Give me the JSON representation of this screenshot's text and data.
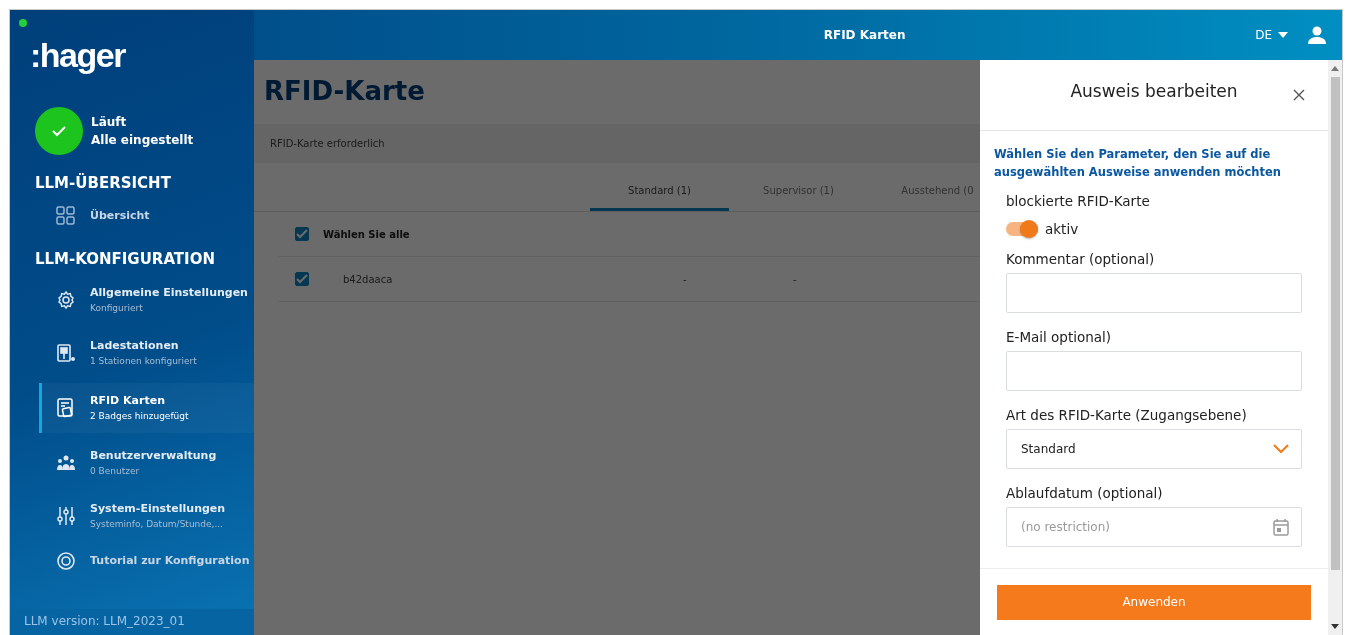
{
  "sidebar": {
    "logo": ":hager",
    "status": {
      "title": "Läuft",
      "subtitle": "Alle eingestellt"
    },
    "sections": [
      {
        "heading": "LLM-ÜBERSICHT",
        "items": [
          {
            "kind": "grid",
            "label": "Übersicht",
            "selected": false
          }
        ]
      },
      {
        "heading": "LLM-KONFIGURATION",
        "items": [
          {
            "kind": "gear",
            "label": "Allgemeine Einstellungen",
            "subtitle": "Konfiguriert",
            "selected": false
          },
          {
            "kind": "charger",
            "label": "Ladestationen",
            "subtitle": "1 Stationen konfiguriert",
            "selected": false
          },
          {
            "kind": "card",
            "label": "RFID Karten",
            "subtitle": "2 Badges hinzugefügt",
            "selected": true
          },
          {
            "kind": "users",
            "label": "Benutzerverwaltung",
            "subtitle": "0 Benutzer",
            "selected": false
          },
          {
            "kind": "sliders",
            "label": "System-Einstellungen",
            "subtitle": "Systeminfo, Datum/Stunde,...",
            "selected": false
          },
          {
            "kind": "help",
            "label": "Tutorial zur Konfiguration",
            "selected": false
          }
        ]
      }
    ],
    "version": "LLM version: LLM_2023_01"
  },
  "top_bar": {
    "title": "RFID Karten",
    "language": "DE"
  },
  "page": {
    "title": "RFID-Karte",
    "subheader": "RFID-Karte erforderlich",
    "tabs": [
      {
        "label": "Standard (1)",
        "selected": true
      },
      {
        "label": "Supervisor (1)",
        "selected": false
      },
      {
        "label": "Ausstehend (0",
        "selected": false
      }
    ],
    "select_all": {
      "label": "Wählen Sie alle",
      "checked": true
    },
    "rows": [
      {
        "checked": true,
        "cells": [
          "b42daaca",
          "-",
          "-"
        ]
      }
    ]
  },
  "panel": {
    "title": "Ausweis bearbeiten",
    "intro": "Wählen Sie den Parameter, den Sie auf die ausgewählten Ausweise anwenden möchten",
    "blocked": {
      "label": "blockierte RFID-Karte",
      "toggle_label": "aktiv",
      "on": true
    },
    "fields": [
      {
        "kind": "text",
        "label": "Kommentar (optional)"
      },
      {
        "kind": "text",
        "label": "E-Mail optional)"
      },
      {
        "kind": "select",
        "label": "Art des RFID-Karte (Zugangsebene)",
        "value": "Standard"
      },
      {
        "kind": "date",
        "label": "Ablaufdatum (optional)",
        "placeholder": "(no restriction)"
      }
    ],
    "button": "Anwenden"
  }
}
